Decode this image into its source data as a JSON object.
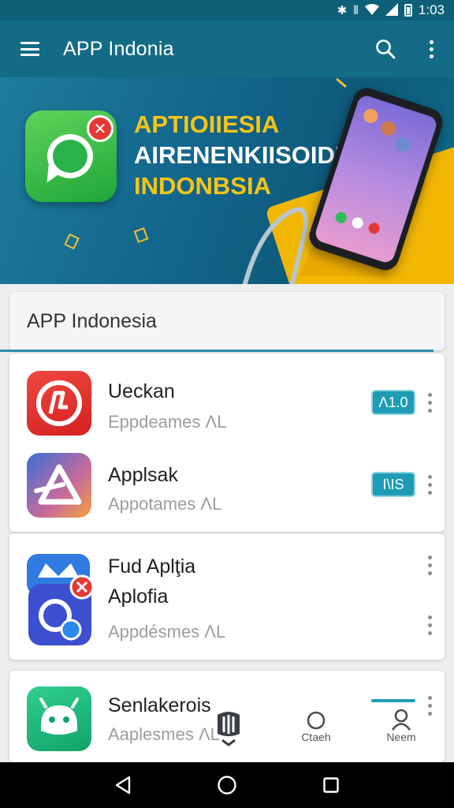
{
  "status_bar": {
    "time": "1:03",
    "icons": [
      "bluetooth-icon",
      "vibrate-icon",
      "wifi-icon",
      "signal-icon",
      "battery-icon"
    ]
  },
  "app_bar": {
    "title": "APP Indonia",
    "icons": [
      "menu-icon",
      "search-icon",
      "more-vert-icon"
    ]
  },
  "banner": {
    "lines": [
      "APTIOIIESIA",
      "AIRENENKIISOIDIAN",
      "INDONBSIA"
    ],
    "colors": {
      "yellow": "#f5c518",
      "white": "#ffffff"
    }
  },
  "section": {
    "title": "APP Indonesia"
  },
  "apps": [
    {
      "name": "Ueckan",
      "subtitle": "Eppdeames ΛL",
      "badge": "Λ1.0",
      "icon": "red-music-icon",
      "color": "#e53935"
    },
    {
      "name": "Applsak",
      "subtitle": "Appotames ΛL",
      "badge": "I\\IS",
      "icon": "triangle-logo-icon",
      "color": "#f4a23b"
    },
    {
      "name_line1": "Fud Aplţia",
      "name_line2": "Aplofia",
      "subtitle": "Appdésmes ΛL",
      "icon": "blue-chat-icon",
      "color": "#3b5bd6"
    },
    {
      "name": "Senlakerois",
      "subtitle": "Aaplesmes ΛL",
      "icon": "green-android-icon",
      "color": "#21b57a"
    }
  ],
  "bottom_nav": [
    {
      "label": "Ctaeh",
      "icon": "circle-icon"
    },
    {
      "label": "Neem",
      "icon": "person-icon"
    }
  ],
  "accent": "#1f9cb5",
  "appbar_color": "#136b85"
}
